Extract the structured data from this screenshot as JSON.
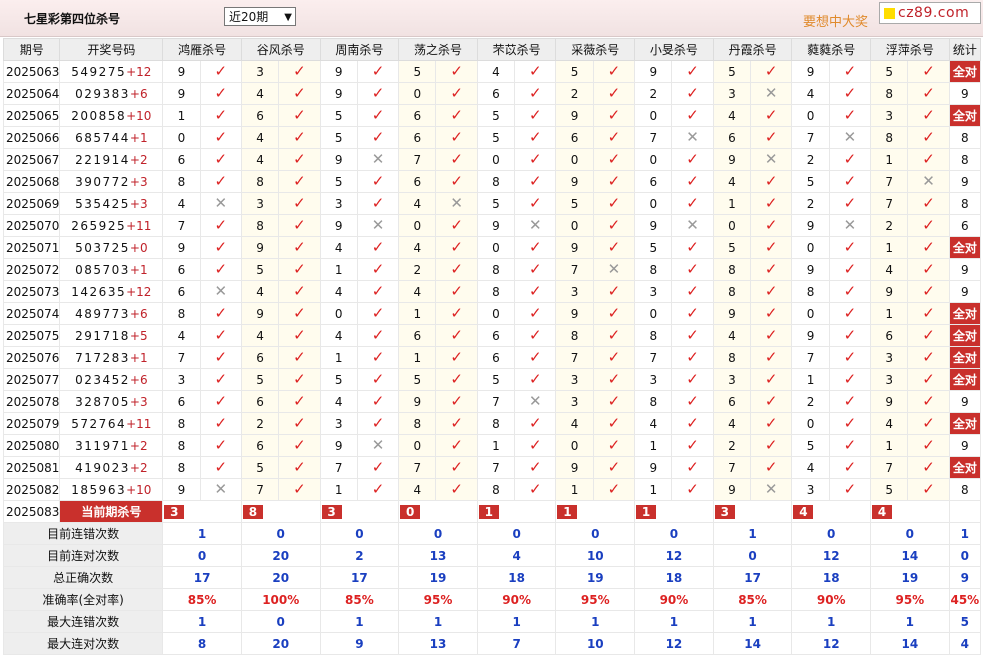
{
  "header": {
    "title": "七星彩第四位杀号",
    "period_select": "近20期",
    "slogan": "要想中大奖",
    "logo": "cz89.com"
  },
  "columns": {
    "issue": "期号",
    "draw": "开奖号码",
    "experts": [
      "鸿雁杀号",
      "谷风杀号",
      "周南杀号",
      "荡之杀号",
      "芣苡杀号",
      "采薇杀号",
      "小旻杀号",
      "丹霞杀号",
      "蕤蕤杀号",
      "浮萍杀号"
    ],
    "stat": "统计"
  },
  "rows": [
    {
      "issue": "2025063",
      "draw": "549275",
      "sum": "+12",
      "kills": [
        [
          9,
          1
        ],
        [
          3,
          1
        ],
        [
          9,
          1
        ],
        [
          5,
          1
        ],
        [
          4,
          1
        ],
        [
          5,
          1
        ],
        [
          9,
          1
        ],
        [
          5,
          1
        ],
        [
          9,
          1
        ],
        [
          5,
          1
        ]
      ],
      "stat": "全对"
    },
    {
      "issue": "2025064",
      "draw": "029383",
      "sum": "+6",
      "kills": [
        [
          9,
          1
        ],
        [
          4,
          1
        ],
        [
          9,
          1
        ],
        [
          0,
          1
        ],
        [
          6,
          1
        ],
        [
          2,
          1
        ],
        [
          2,
          1
        ],
        [
          3,
          0
        ],
        [
          4,
          1
        ],
        [
          8,
          1
        ]
      ],
      "stat": "9"
    },
    {
      "issue": "2025065",
      "draw": "200858",
      "sum": "+10",
      "kills": [
        [
          1,
          1
        ],
        [
          6,
          1
        ],
        [
          5,
          1
        ],
        [
          6,
          1
        ],
        [
          5,
          1
        ],
        [
          9,
          1
        ],
        [
          0,
          1
        ],
        [
          4,
          1
        ],
        [
          0,
          1
        ],
        [
          3,
          1
        ]
      ],
      "stat": "全对"
    },
    {
      "issue": "2025066",
      "draw": "685744",
      "sum": "+1",
      "kills": [
        [
          0,
          1
        ],
        [
          4,
          1
        ],
        [
          5,
          1
        ],
        [
          6,
          1
        ],
        [
          5,
          1
        ],
        [
          6,
          1
        ],
        [
          7,
          0
        ],
        [
          6,
          1
        ],
        [
          7,
          0
        ],
        [
          8,
          1
        ]
      ],
      "stat": "8"
    },
    {
      "issue": "2025067",
      "draw": "221914",
      "sum": "+2",
      "kills": [
        [
          6,
          1
        ],
        [
          4,
          1
        ],
        [
          9,
          0
        ],
        [
          7,
          1
        ],
        [
          0,
          1
        ],
        [
          0,
          1
        ],
        [
          0,
          1
        ],
        [
          9,
          0
        ],
        [
          2,
          1
        ],
        [
          1,
          1
        ]
      ],
      "stat": "8"
    },
    {
      "issue": "2025068",
      "draw": "390772",
      "sum": "+3",
      "kills": [
        [
          8,
          1
        ],
        [
          8,
          1
        ],
        [
          5,
          1
        ],
        [
          6,
          1
        ],
        [
          8,
          1
        ],
        [
          9,
          1
        ],
        [
          6,
          1
        ],
        [
          4,
          1
        ],
        [
          5,
          1
        ],
        [
          7,
          0
        ]
      ],
      "stat": "9"
    },
    {
      "issue": "2025069",
      "draw": "535425",
      "sum": "+3",
      "kills": [
        [
          4,
          0
        ],
        [
          3,
          1
        ],
        [
          3,
          1
        ],
        [
          4,
          0
        ],
        [
          5,
          1
        ],
        [
          5,
          1
        ],
        [
          0,
          1
        ],
        [
          1,
          1
        ],
        [
          2,
          1
        ],
        [
          7,
          1
        ]
      ],
      "stat": "8"
    },
    {
      "issue": "2025070",
      "draw": "265925",
      "sum": "+11",
      "kills": [
        [
          7,
          1
        ],
        [
          8,
          1
        ],
        [
          9,
          0
        ],
        [
          0,
          1
        ],
        [
          9,
          0
        ],
        [
          0,
          1
        ],
        [
          9,
          0
        ],
        [
          0,
          1
        ],
        [
          9,
          0
        ],
        [
          2,
          1
        ]
      ],
      "stat": "6"
    },
    {
      "issue": "2025071",
      "draw": "503725",
      "sum": "+0",
      "kills": [
        [
          9,
          1
        ],
        [
          9,
          1
        ],
        [
          4,
          1
        ],
        [
          4,
          1
        ],
        [
          0,
          1
        ],
        [
          9,
          1
        ],
        [
          5,
          1
        ],
        [
          5,
          1
        ],
        [
          0,
          1
        ],
        [
          1,
          1
        ]
      ],
      "stat": "全对"
    },
    {
      "issue": "2025072",
      "draw": "085703",
      "sum": "+1",
      "kills": [
        [
          6,
          1
        ],
        [
          5,
          1
        ],
        [
          1,
          1
        ],
        [
          2,
          1
        ],
        [
          8,
          1
        ],
        [
          7,
          0
        ],
        [
          8,
          1
        ],
        [
          8,
          1
        ],
        [
          9,
          1
        ],
        [
          4,
          1
        ]
      ],
      "stat": "9"
    },
    {
      "issue": "2025073",
      "draw": "142635",
      "sum": "+12",
      "kills": [
        [
          6,
          0
        ],
        [
          4,
          1
        ],
        [
          4,
          1
        ],
        [
          4,
          1
        ],
        [
          8,
          1
        ],
        [
          3,
          1
        ],
        [
          3,
          1
        ],
        [
          8,
          1
        ],
        [
          8,
          1
        ],
        [
          9,
          1
        ]
      ],
      "stat": "9"
    },
    {
      "issue": "2025074",
      "draw": "489773",
      "sum": "+6",
      "kills": [
        [
          8,
          1
        ],
        [
          9,
          1
        ],
        [
          0,
          1
        ],
        [
          1,
          1
        ],
        [
          0,
          1
        ],
        [
          9,
          1
        ],
        [
          0,
          1
        ],
        [
          9,
          1
        ],
        [
          0,
          1
        ],
        [
          1,
          1
        ]
      ],
      "stat": "全对"
    },
    {
      "issue": "2025075",
      "draw": "291718",
      "sum": "+5",
      "kills": [
        [
          4,
          1
        ],
        [
          4,
          1
        ],
        [
          4,
          1
        ],
        [
          6,
          1
        ],
        [
          6,
          1
        ],
        [
          8,
          1
        ],
        [
          8,
          1
        ],
        [
          4,
          1
        ],
        [
          9,
          1
        ],
        [
          6,
          1
        ]
      ],
      "stat": "全对"
    },
    {
      "issue": "2025076",
      "draw": "717283",
      "sum": "+1",
      "kills": [
        [
          7,
          1
        ],
        [
          6,
          1
        ],
        [
          1,
          1
        ],
        [
          1,
          1
        ],
        [
          6,
          1
        ],
        [
          7,
          1
        ],
        [
          7,
          1
        ],
        [
          8,
          1
        ],
        [
          7,
          1
        ],
        [
          3,
          1
        ]
      ],
      "stat": "全对"
    },
    {
      "issue": "2025077",
      "draw": "023452",
      "sum": "+6",
      "kills": [
        [
          3,
          1
        ],
        [
          5,
          1
        ],
        [
          5,
          1
        ],
        [
          5,
          1
        ],
        [
          5,
          1
        ],
        [
          3,
          1
        ],
        [
          3,
          1
        ],
        [
          3,
          1
        ],
        [
          1,
          1
        ],
        [
          3,
          1
        ]
      ],
      "stat": "全对"
    },
    {
      "issue": "2025078",
      "draw": "328705",
      "sum": "+3",
      "kills": [
        [
          6,
          1
        ],
        [
          6,
          1
        ],
        [
          4,
          1
        ],
        [
          9,
          1
        ],
        [
          7,
          0
        ],
        [
          3,
          1
        ],
        [
          8,
          1
        ],
        [
          6,
          1
        ],
        [
          2,
          1
        ],
        [
          9,
          1
        ]
      ],
      "stat": "9"
    },
    {
      "issue": "2025079",
      "draw": "572764",
      "sum": "+11",
      "kills": [
        [
          8,
          1
        ],
        [
          2,
          1
        ],
        [
          3,
          1
        ],
        [
          8,
          1
        ],
        [
          8,
          1
        ],
        [
          4,
          1
        ],
        [
          4,
          1
        ],
        [
          4,
          1
        ],
        [
          0,
          1
        ],
        [
          4,
          1
        ]
      ],
      "stat": "全对"
    },
    {
      "issue": "2025080",
      "draw": "311971",
      "sum": "+2",
      "kills": [
        [
          8,
          1
        ],
        [
          6,
          1
        ],
        [
          9,
          0
        ],
        [
          0,
          1
        ],
        [
          1,
          1
        ],
        [
          0,
          1
        ],
        [
          1,
          1
        ],
        [
          2,
          1
        ],
        [
          5,
          1
        ],
        [
          1,
          1
        ]
      ],
      "stat": "9"
    },
    {
      "issue": "2025081",
      "draw": "419023",
      "sum": "+2",
      "kills": [
        [
          8,
          1
        ],
        [
          5,
          1
        ],
        [
          7,
          1
        ],
        [
          7,
          1
        ],
        [
          7,
          1
        ],
        [
          9,
          1
        ],
        [
          9,
          1
        ],
        [
          7,
          1
        ],
        [
          4,
          1
        ],
        [
          7,
          1
        ]
      ],
      "stat": "全对"
    },
    {
      "issue": "2025082",
      "draw": "185963",
      "sum": "+10",
      "kills": [
        [
          9,
          0
        ],
        [
          7,
          1
        ],
        [
          1,
          1
        ],
        [
          4,
          1
        ],
        [
          8,
          1
        ],
        [
          1,
          1
        ],
        [
          1,
          1
        ],
        [
          9,
          0
        ],
        [
          3,
          1
        ],
        [
          5,
          1
        ]
      ],
      "stat": "8"
    }
  ],
  "current": {
    "issue": "2025083",
    "label": "当前期杀号",
    "kills": [
      "3",
      "8",
      "3",
      "0",
      "1",
      "1",
      "1",
      "3",
      "4",
      "4"
    ]
  },
  "stats": [
    {
      "label": "目前连错次数",
      "values": [
        "1",
        "0",
        "0",
        "0",
        "0",
        "0",
        "0",
        "1",
        "0",
        "0"
      ],
      "total": "1"
    },
    {
      "label": "目前连对次数",
      "values": [
        "0",
        "20",
        "2",
        "13",
        "4",
        "10",
        "12",
        "0",
        "12",
        "14"
      ],
      "total": "0"
    },
    {
      "label": "总正确次数",
      "values": [
        "17",
        "20",
        "17",
        "19",
        "18",
        "19",
        "18",
        "17",
        "18",
        "19"
      ],
      "total": "9"
    },
    {
      "label": "准确率(全对率)",
      "values": [
        "85%",
        "100%",
        "85%",
        "95%",
        "90%",
        "95%",
        "90%",
        "85%",
        "90%",
        "95%"
      ],
      "total": "45%"
    },
    {
      "label": "最大连错次数",
      "values": [
        "1",
        "0",
        "1",
        "1",
        "1",
        "1",
        "1",
        "1",
        "1",
        "1"
      ],
      "total": "5"
    },
    {
      "label": "最大连对次数",
      "values": [
        "8",
        "20",
        "9",
        "13",
        "7",
        "10",
        "12",
        "14",
        "12",
        "14"
      ],
      "total": "4"
    }
  ],
  "icons": {
    "correct": "check-icon",
    "wrong": "cross-icon"
  },
  "colors": {
    "accent": "#c9302c",
    "stat_blue": "#1a3fc0",
    "check": "#dd2222",
    "cross": "#999999",
    "header_bg": "#eeeeee",
    "alt_bg": "#fffcee"
  }
}
